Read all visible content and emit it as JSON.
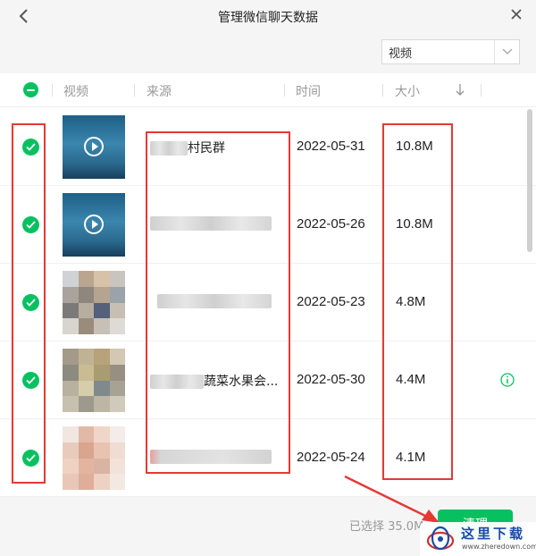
{
  "window": {
    "title": "管理微信聊天数据"
  },
  "filter": {
    "selected": "视频"
  },
  "table": {
    "columns": {
      "media": "视频",
      "source": "来源",
      "time": "时间",
      "size": "大小"
    },
    "rows": [
      {
        "type": "video",
        "source_text": "村民群",
        "time": "2022-05-31",
        "size": "10.8M",
        "checked": true
      },
      {
        "type": "video",
        "source_text": "",
        "time": "2022-05-26",
        "size": "10.8M",
        "checked": true
      },
      {
        "type": "image",
        "source_text": "",
        "time": "2022-05-23",
        "size": "4.8M",
        "checked": true
      },
      {
        "type": "image",
        "source_text": "蔬菜水果会...",
        "time": "2022-05-30",
        "size": "4.4M",
        "checked": true,
        "info": true
      },
      {
        "type": "image",
        "source_text": "",
        "time": "2022-05-24",
        "size": "4.1M",
        "checked": true
      }
    ]
  },
  "footer": {
    "selected_label": "已选择 35.0M",
    "clean_button": "清理"
  },
  "watermark": {
    "text": "这里下载",
    "url": "www.zheredown.com"
  },
  "colors": {
    "accent": "#07c160",
    "annotation": "#e53935"
  }
}
